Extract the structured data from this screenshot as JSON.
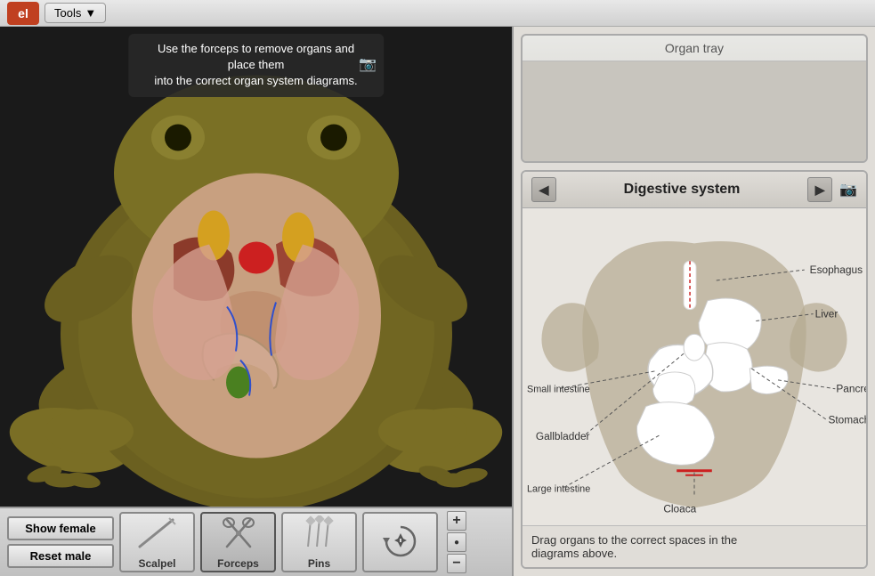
{
  "toolbar": {
    "logo_text": "el",
    "tools_btn_label": "Tools",
    "tools_btn_arrow": "▼"
  },
  "instruction": {
    "text_line1": "Use the forceps to remove organs and place them",
    "text_line2": "into the correct organ system diagrams.",
    "full_text": "Use the forceps to remove organs and place them\ninto the correct organ system diagrams."
  },
  "tools_panel": {
    "show_female_label": "Show female",
    "reset_male_label": "Reset male",
    "scalpel_label": "Scalpel",
    "forceps_label": "Forceps",
    "pins_label": "Pins"
  },
  "organ_tray": {
    "title": "Organ tray"
  },
  "diagram": {
    "title": "Digestive system",
    "labels": {
      "esophagus": "Esophagus",
      "small_intestine": "Small intestine",
      "liver": "Liver",
      "pancreas": "Pancreas",
      "gallbladder": "Gallbladder",
      "stomach": "Stomach",
      "large_intestine": "Large intestine",
      "cloaca": "Cloaca"
    },
    "instruction": "Drag organs to the correct spaces in the\ndiagrams above.",
    "instruction_line1": "Drag organs to the correct spaces in the",
    "instruction_line2": "diagrams above."
  }
}
